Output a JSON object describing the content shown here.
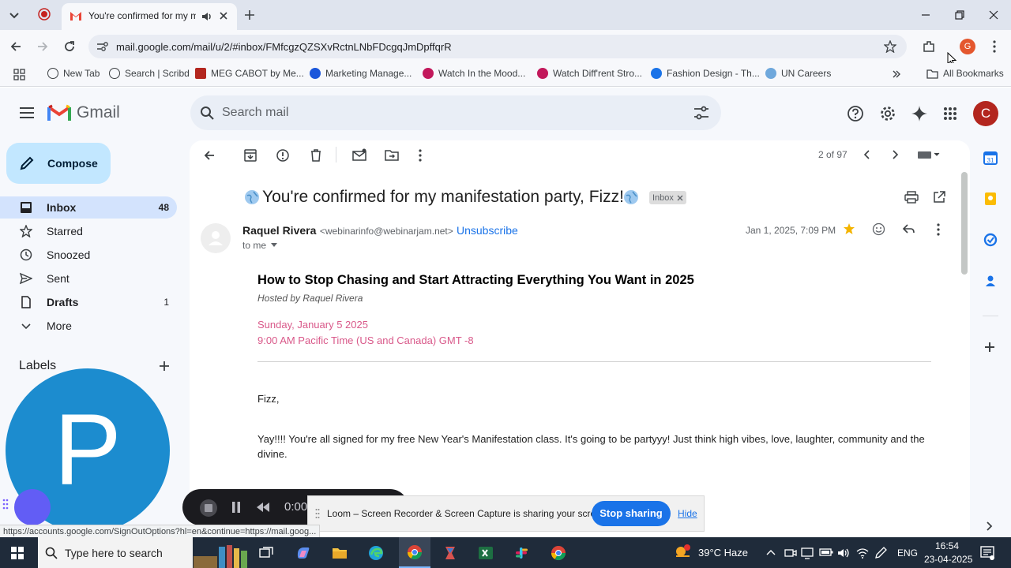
{
  "browser": {
    "tab_title": "You're confirmed for my manifestation party",
    "url": "mail.google.com/mail/u/2/#inbox/FMfcgzQZSXvRctnLNbFDcgqJmDpffqrR",
    "profile_initial": "G",
    "bookmarks": [
      "New Tab",
      "Search | Scribd",
      "MEG CABOT by Me...",
      "Marketing Manage...",
      "Watch In the Mood...",
      "Watch Diff'rent Stro...",
      "Fashion Design - Th...",
      "UN Careers"
    ],
    "all_bookmarks": "All Bookmarks"
  },
  "gmail": {
    "logo": "Gmail",
    "search_placeholder": "Search mail",
    "account_initial": "C",
    "compose": "Compose",
    "nav": [
      {
        "label": "Inbox",
        "count": "48"
      },
      {
        "label": "Starred",
        "count": ""
      },
      {
        "label": "Snoozed",
        "count": ""
      },
      {
        "label": "Sent",
        "count": ""
      },
      {
        "label": "Drafts",
        "count": "1"
      },
      {
        "label": "More",
        "count": ""
      }
    ],
    "labels_heading": "Labels",
    "pagination": "2 of 97"
  },
  "email": {
    "subject": "You're confirmed for my manifestation party, Fizz!",
    "label_chip": "Inbox",
    "sender_name": "Raquel Rivera",
    "sender_email": "<webinarinfo@webinarjam.net>",
    "unsubscribe": "Unsubscribe",
    "date": "Jan 1, 2025, 7:09 PM",
    "to": "to me",
    "headline": "How to Stop Chasing and Start Attracting Everything You Want in 2025",
    "hosted_by": "Hosted by Raquel Rivera",
    "event_date": "Sunday, January 5 2025",
    "event_time": "9:00 AM Pacific Time (US and Canada) GMT -8",
    "greeting": "Fizz,",
    "paragraph": "Yay!!!! You're all signed for my free New Year's Manifestation class. It's going to be partyyy! Just think high vibes, love, laughter, community and the divine."
  },
  "overlay": {
    "avatar_letter": "P",
    "recorder_time": "0:00",
    "sharing_text": "Loom – Screen Recorder & Screen Capture is sharing your screen.",
    "stop_sharing": "Stop sharing",
    "hide": "Hide",
    "status_url": "https://accounts.google.com/SignOutOptions?hl=en&continue=https://mail.goog..."
  },
  "taskbar": {
    "search_placeholder": "Type here to search",
    "weather": "39°C Haze",
    "language": "ENG",
    "time": "16:54",
    "date": "23-04-2025"
  },
  "colors": {
    "accent": "#0b57d0",
    "compose_bg": "#c2e7ff",
    "event_pink": "#d9598a",
    "star": "#f4b400"
  }
}
